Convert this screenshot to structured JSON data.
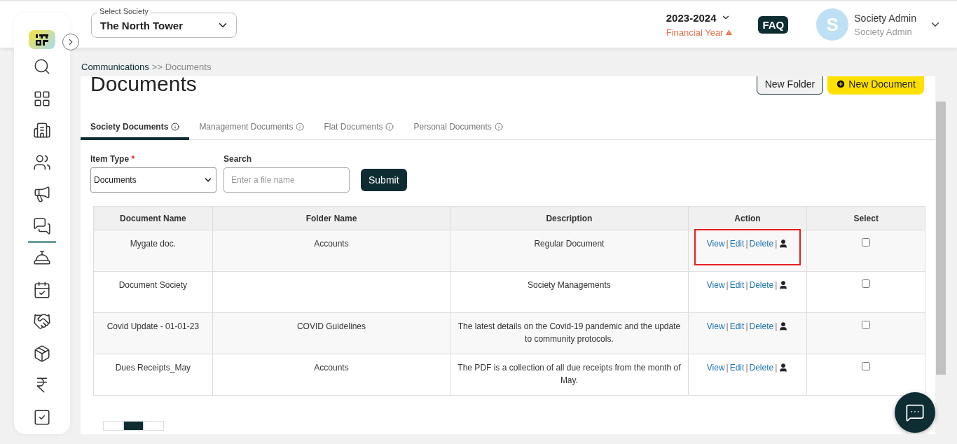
{
  "header": {
    "society_select": {
      "label": "Select Society",
      "value": "The North Tower"
    },
    "year": {
      "value": "2023-2024",
      "label": "Financial Year"
    },
    "faq": "FAQ",
    "user": {
      "initial": "S",
      "name": "Society Admin",
      "role": "Society Admin"
    }
  },
  "sidebar": {
    "items": [
      {
        "selected": false
      },
      {
        "selected": false
      },
      {
        "selected": false
      },
      {
        "selected": false
      },
      {
        "selected": false
      },
      {
        "selected": true
      },
      {
        "selected": false
      },
      {
        "selected": false
      },
      {
        "selected": false
      },
      {
        "selected": false
      },
      {
        "selected": false
      },
      {
        "selected": false
      }
    ]
  },
  "breadcrumb": {
    "parent": "Communications",
    "separator": ">>",
    "current": "Documents"
  },
  "page_title": "Documents",
  "buttons": {
    "new_folder": "New Folder",
    "new_document": "New Document"
  },
  "tabs": [
    {
      "label": "Society Documents",
      "selected": true
    },
    {
      "label": "Management Documents",
      "selected": false
    },
    {
      "label": "Flat Documents",
      "selected": false
    },
    {
      "label": "Personal Documents",
      "selected": false
    }
  ],
  "filters": {
    "item_type": {
      "label": "Item Type",
      "required_mark": "*",
      "value": "Documents"
    },
    "search": {
      "label": "Search",
      "placeholder": "Enter a file name"
    },
    "submit": "Submit"
  },
  "table": {
    "columns": [
      "Document Name",
      "Folder Name",
      "Description",
      "Action",
      "Select"
    ],
    "rows": [
      {
        "document_name": "Mygate doc.",
        "folder_name": "Accounts",
        "description": "Regular Document",
        "actions": [
          "View",
          "Edit",
          "Delete"
        ],
        "separator": "|",
        "checked": false,
        "highlighted": true
      },
      {
        "document_name": "Document Society",
        "description": "Society Managements",
        "actions": [
          "View",
          "Edit",
          "Delete"
        ],
        "separator": "|",
        "checked": false,
        "highlighted": false
      },
      {
        "document_name": "Covid Update - 01-01-23",
        "folder_name": "COVID Guidelines",
        "description": "The latest details on the Covid-19 pandemic and the update to community protocols.",
        "actions": [
          "View",
          "Edit",
          "Delete"
        ],
        "separator": "|",
        "checked": false,
        "highlighted": false
      },
      {
        "document_name": "Dues Receipts_May",
        "folder_name": "Accounts",
        "description": "The PDF is a collection of all due receipts from the month of May.",
        "actions": [
          "View",
          "Edit",
          "Delete"
        ],
        "separator": "|",
        "checked": false,
        "highlighted": false
      }
    ]
  },
  "pagination": [
    {
      "selected": false
    },
    {
      "selected": true
    },
    {
      "selected": false
    }
  ]
}
